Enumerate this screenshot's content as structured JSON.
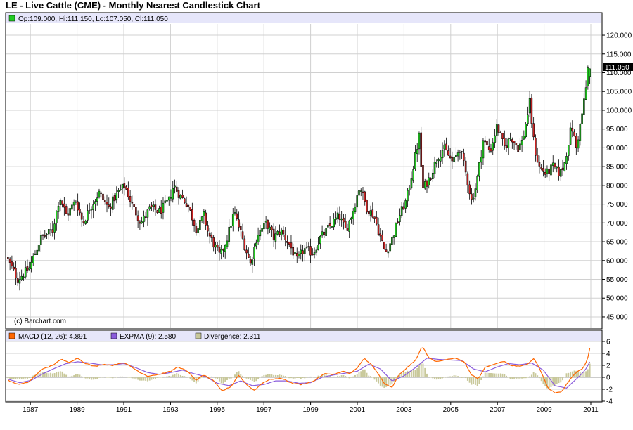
{
  "title": "LE - Live Cattle (CME) - Monthly Nearest Candlestick Chart",
  "ohlc_readout": "Op:109.000, Hi:111.150, Lo:107.050, Cl:111.050",
  "watermark": "(c) Barchart.com",
  "last_price_label": "111.050",
  "macd_legend": {
    "macd": "MACD (12, 26): 4.891",
    "expma": "EXPMA (9): 2.580",
    "divergence": "Divergence: 2.311"
  },
  "colors": {
    "up": "#22cc22",
    "down": "#cc2222",
    "macd": "#ff6600",
    "expma": "#8a5cdc",
    "divergence": "#c8c89a",
    "legend_bg": "#e6e6fa",
    "grid": "#d0d0d0"
  },
  "chart_data": [
    {
      "type": "candlestick",
      "title": "LE - Live Cattle (CME) - Monthly Nearest Candlestick Chart",
      "ylim": [
        42,
        123
      ],
      "y_ticks": [
        "120.000",
        "115.000",
        "110.000",
        "105.000",
        "100.000",
        "95.000",
        "90.000",
        "85.000",
        "80.000",
        "75.000",
        "70.000",
        "65.000",
        "60.000",
        "55.000",
        "50.000",
        "45.000"
      ],
      "y_tick_values": [
        120,
        115,
        110,
        105,
        100,
        95,
        90,
        85,
        80,
        75,
        70,
        65,
        60,
        55,
        50,
        45
      ],
      "x_range": [
        1986.0,
        2011.0
      ],
      "last": {
        "open": 109.0,
        "high": 111.15,
        "low": 107.05,
        "close": 111.05
      },
      "anchors": [
        [
          1986.0,
          61
        ],
        [
          1986.5,
          55
        ],
        [
          1987.0,
          58
        ],
        [
          1987.5,
          66
        ],
        [
          1988.0,
          68
        ],
        [
          1988.3,
          77
        ],
        [
          1988.6,
          72
        ],
        [
          1989.0,
          76
        ],
        [
          1989.3,
          70
        ],
        [
          1989.6,
          74
        ],
        [
          1990.0,
          78
        ],
        [
          1990.4,
          74
        ],
        [
          1990.8,
          78
        ],
        [
          1991.1,
          80
        ],
        [
          1991.4,
          75
        ],
        [
          1991.8,
          70
        ],
        [
          1992.2,
          74
        ],
        [
          1992.6,
          73
        ],
        [
          1993.0,
          76
        ],
        [
          1993.2,
          80
        ],
        [
          1993.5,
          77
        ],
        [
          1993.8,
          75
        ],
        [
          1994.2,
          68
        ],
        [
          1994.5,
          72
        ],
        [
          1994.7,
          67
        ],
        [
          1995.2,
          61
        ],
        [
          1995.5,
          66
        ],
        [
          1995.8,
          73
        ],
        [
          1996.2,
          65
        ],
        [
          1996.5,
          59
        ],
        [
          1996.8,
          67
        ],
        [
          1997.2,
          70
        ],
        [
          1997.5,
          66
        ],
        [
          1997.8,
          68
        ],
        [
          1998.2,
          64
        ],
        [
          1998.5,
          60
        ],
        [
          1998.8,
          63
        ],
        [
          1999.2,
          62
        ],
        [
          1999.5,
          66
        ],
        [
          1999.9,
          69
        ],
        [
          2000.3,
          72
        ],
        [
          2000.6,
          68
        ],
        [
          2000.9,
          73
        ],
        [
          2001.2,
          80
        ],
        [
          2001.5,
          74
        ],
        [
          2001.8,
          72
        ],
        [
          2002.1,
          66
        ],
        [
          2002.3,
          62
        ],
        [
          2002.6,
          66
        ],
        [
          2002.9,
          72
        ],
        [
          2003.2,
          76
        ],
        [
          2003.5,
          85
        ],
        [
          2003.75,
          93
        ],
        [
          2003.9,
          79
        ],
        [
          2004.2,
          82
        ],
        [
          2004.5,
          87
        ],
        [
          2004.8,
          90
        ],
        [
          2005.2,
          86
        ],
        [
          2005.5,
          90
        ],
        [
          2005.8,
          82
        ],
        [
          2006.0,
          76
        ],
        [
          2006.2,
          80
        ],
        [
          2006.5,
          92
        ],
        [
          2006.8,
          89
        ],
        [
          2007.1,
          96
        ],
        [
          2007.4,
          90
        ],
        [
          2007.7,
          93
        ],
        [
          2008.0,
          90
        ],
        [
          2008.2,
          92
        ],
        [
          2008.5,
          102
        ],
        [
          2008.7,
          90
        ],
        [
          2008.9,
          85
        ],
        [
          2009.2,
          83
        ],
        [
          2009.5,
          85
        ],
        [
          2009.8,
          83
        ],
        [
          2010.0,
          86
        ],
        [
          2010.3,
          96
        ],
        [
          2010.5,
          90
        ],
        [
          2010.7,
          97
        ],
        [
          2010.9,
          105
        ],
        [
          2011.0,
          111
        ]
      ]
    },
    {
      "type": "line",
      "title": "MACD",
      "ylim": [
        -4,
        6
      ],
      "y_ticks": [
        "6",
        "4",
        "2",
        "0",
        "-2",
        "-4"
      ],
      "y_tick_values": [
        6,
        4,
        2,
        0,
        -2,
        -4
      ],
      "categories": [
        "1987",
        "1989",
        "1991",
        "1993",
        "1995",
        "1997",
        "1999",
        "2001",
        "2003",
        "2005",
        "2007",
        "2009",
        "2011"
      ],
      "x_range": [
        1986.0,
        2011.0
      ],
      "series": [
        {
          "name": "MACD (12, 26)",
          "last": 4.891
        },
        {
          "name": "EXPMA (9)",
          "last": 2.58
        },
        {
          "name": "Divergence",
          "last": 2.311
        }
      ],
      "macd_anchors": [
        [
          1986.0,
          -0.5
        ],
        [
          1986.4,
          -1.2
        ],
        [
          1986.9,
          -0.8
        ],
        [
          1987.4,
          1.2
        ],
        [
          1987.9,
          2.0
        ],
        [
          1988.3,
          3.0
        ],
        [
          1988.6,
          2.5
        ],
        [
          1989.0,
          3.2
        ],
        [
          1989.3,
          2.4
        ],
        [
          1989.7,
          1.8
        ],
        [
          1990.1,
          2.2
        ],
        [
          1990.5,
          2.0
        ],
        [
          1990.9,
          2.5
        ],
        [
          1991.2,
          2.0
        ],
        [
          1991.6,
          1.0
        ],
        [
          1992.0,
          0.2
        ],
        [
          1992.5,
          0.5
        ],
        [
          1993.0,
          1.0
        ],
        [
          1993.3,
          1.8
        ],
        [
          1993.7,
          1.0
        ],
        [
          1994.1,
          -0.5
        ],
        [
          1994.4,
          0.4
        ],
        [
          1994.8,
          -0.5
        ],
        [
          1995.2,
          -2.3
        ],
        [
          1995.6,
          -1.5
        ],
        [
          1995.9,
          0.4
        ],
        [
          1996.3,
          -1.4
        ],
        [
          1996.6,
          -2.2
        ],
        [
          1996.9,
          -1.0
        ],
        [
          1997.3,
          -0.3
        ],
        [
          1997.8,
          -0.2
        ],
        [
          1998.2,
          -1.0
        ],
        [
          1998.6,
          -1.2
        ],
        [
          1999.1,
          -0.7
        ],
        [
          1999.6,
          0.6
        ],
        [
          2000.0,
          0.5
        ],
        [
          2000.4,
          1.0
        ],
        [
          2000.7,
          0.6
        ],
        [
          2001.0,
          1.5
        ],
        [
          2001.3,
          3.2
        ],
        [
          2001.6,
          2.2
        ],
        [
          2001.9,
          0.6
        ],
        [
          2002.2,
          -1.2
        ],
        [
          2002.5,
          -1.7
        ],
        [
          2002.8,
          0.4
        ],
        [
          2003.2,
          1.8
        ],
        [
          2003.5,
          2.8
        ],
        [
          2003.8,
          5.2
        ],
        [
          2004.1,
          3.2
        ],
        [
          2004.4,
          2.6
        ],
        [
          2004.8,
          3.0
        ],
        [
          2005.2,
          3.2
        ],
        [
          2005.6,
          2.6
        ],
        [
          2005.9,
          0.5
        ],
        [
          2006.2,
          -0.3
        ],
        [
          2006.5,
          1.6
        ],
        [
          2006.9,
          2.2
        ],
        [
          2007.3,
          2.7
        ],
        [
          2007.6,
          2.0
        ],
        [
          2008.0,
          1.8
        ],
        [
          2008.3,
          2.2
        ],
        [
          2008.6,
          3.2
        ],
        [
          2008.9,
          1.0
        ],
        [
          2009.2,
          -1.8
        ],
        [
          2009.5,
          -2.6
        ],
        [
          2009.8,
          -2.4
        ],
        [
          2010.1,
          -0.6
        ],
        [
          2010.4,
          0.8
        ],
        [
          2010.7,
          1.5
        ],
        [
          2010.9,
          3.0
        ],
        [
          2011.0,
          4.9
        ]
      ],
      "expma_anchors": [
        [
          1986.0,
          -0.3
        ],
        [
          1986.5,
          -0.9
        ],
        [
          1987.0,
          -0.5
        ],
        [
          1987.5,
          0.6
        ],
        [
          1988.0,
          1.5
        ],
        [
          1988.5,
          2.3
        ],
        [
          1989.0,
          2.6
        ],
        [
          1989.5,
          2.4
        ],
        [
          1990.0,
          2.1
        ],
        [
          1990.5,
          2.1
        ],
        [
          1991.0,
          2.3
        ],
        [
          1991.5,
          1.6
        ],
        [
          1992.0,
          0.8
        ],
        [
          1992.5,
          0.5
        ],
        [
          1993.0,
          0.8
        ],
        [
          1993.5,
          1.2
        ],
        [
          1994.0,
          0.6
        ],
        [
          1994.5,
          0.1
        ],
        [
          1995.0,
          -1.0
        ],
        [
          1995.5,
          -1.4
        ],
        [
          1996.0,
          -0.6
        ],
        [
          1996.5,
          -1.4
        ],
        [
          1997.0,
          -1.2
        ],
        [
          1997.5,
          -0.6
        ],
        [
          1998.0,
          -0.6
        ],
        [
          1998.5,
          -1.0
        ],
        [
          1999.0,
          -0.9
        ],
        [
          1999.5,
          0.0
        ],
        [
          2000.0,
          0.4
        ],
        [
          2000.5,
          0.7
        ],
        [
          2001.0,
          1.0
        ],
        [
          2001.5,
          2.2
        ],
        [
          2002.0,
          1.4
        ],
        [
          2002.5,
          -0.6
        ],
        [
          2003.0,
          0.2
        ],
        [
          2003.5,
          1.6
        ],
        [
          2004.0,
          3.2
        ],
        [
          2004.5,
          3.0
        ],
        [
          2005.0,
          2.9
        ],
        [
          2005.5,
          2.8
        ],
        [
          2006.0,
          1.4
        ],
        [
          2006.5,
          0.9
        ],
        [
          2007.0,
          1.7
        ],
        [
          2007.5,
          2.3
        ],
        [
          2008.0,
          2.1
        ],
        [
          2008.5,
          2.4
        ],
        [
          2009.0,
          1.2
        ],
        [
          2009.5,
          -1.4
        ],
        [
          2010.0,
          -1.8
        ],
        [
          2010.5,
          0.0
        ],
        [
          2010.8,
          1.2
        ],
        [
          2011.0,
          2.58
        ]
      ]
    }
  ]
}
